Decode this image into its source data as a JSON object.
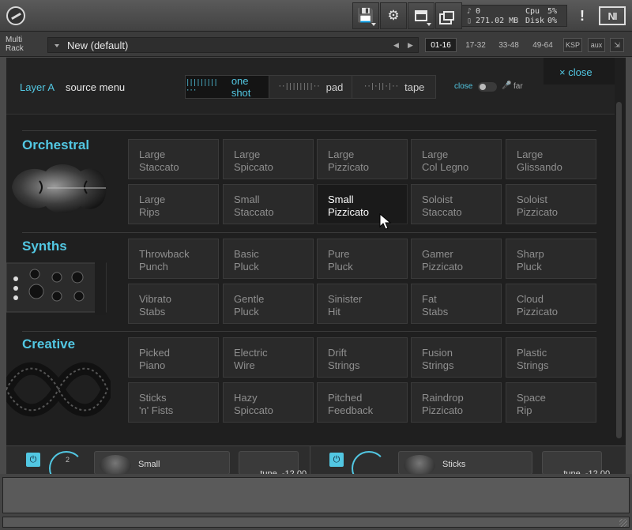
{
  "toolbar": {
    "stats": {
      "voices_icon": "voices-icon",
      "voices": "0",
      "memory": "271.02 MB",
      "cpu_label": "Cpu",
      "cpu_value": "5%",
      "disk_label": "Disk",
      "disk_value": "0%"
    },
    "warning": "!",
    "ni_logo": "NI"
  },
  "rack": {
    "label_line1": "Multi",
    "label_line2": "Rack",
    "preset_name": "New (default)",
    "pages": [
      "01-16",
      "17-32",
      "33-48",
      "49-64"
    ],
    "ksp": "KSP",
    "aux": "aux"
  },
  "layer": {
    "label": "Layer A",
    "source_menu": "source menu",
    "modes": [
      {
        "label": "one shot",
        "wave": "|||||||||···"
      },
      {
        "label": "pad",
        "wave": "··||||||||··"
      },
      {
        "label": "tape",
        "wave": "··|·||·|··"
      }
    ],
    "close_label": "close",
    "far_label": "far",
    "close_button": "× close"
  },
  "categories": [
    {
      "title": "Orchestral",
      "tiles": [
        "Large\nStaccato",
        "Large\nSpiccato",
        "Large\nPizzicato",
        "Large\nCol Legno",
        "Large\nGlissando",
        "Large\nRips",
        "Small\nStaccato",
        "Small\nPizzicato",
        "Soloist\nStaccato",
        "Soloist\nPizzicato"
      ]
    },
    {
      "title": "Synths",
      "tiles": [
        "Throwback\nPunch",
        "Basic\nPluck",
        "Pure\nPluck",
        "Gamer\nPizzicato",
        "Sharp\nPluck",
        "Vibrato\nStabs",
        "Gentle\nPluck",
        "Sinister\nHit",
        "Fat\nStabs",
        "Cloud\nPizzicato"
      ]
    },
    {
      "title": "Creative",
      "tiles": [
        "Picked\nPiano",
        "Electric\nWire",
        "Drift\nStrings",
        "Fusion\nStrings",
        "Plastic\nStrings",
        "Sticks\n'n' Fists",
        "Hazy\nSpiccato",
        "Pitched\nFeedback",
        "Raindrop\nPizzicato",
        "Space\nRip"
      ]
    }
  ],
  "selected_tile": "Small\nPizzicato",
  "bottom": {
    "left": {
      "ring_number": "2",
      "slot_name": "Small",
      "tune_label": "tune",
      "tune_value": "-12.00"
    },
    "right": {
      "slot_name": "Sticks",
      "tune_label": "tune",
      "tune_value": "-12.00"
    }
  },
  "colors": {
    "accent": "#52c7e2",
    "panel": "#1f1f1f",
    "tile": "#2a2a2a",
    "tile_selected": "#1a1a1a"
  }
}
